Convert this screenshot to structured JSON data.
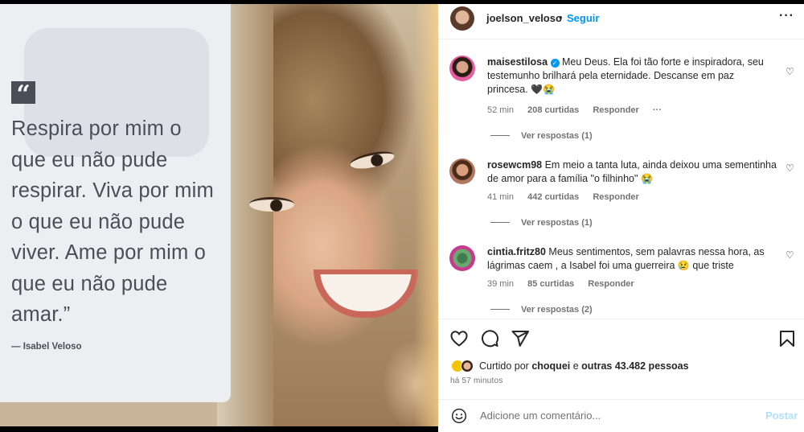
{
  "quote": {
    "mark": "“",
    "text": "Respira por mim o que eu não pude respirar. Viva por mim o que eu não pude viver. Ame por mim o que eu não pude amar.”",
    "author": "— Isabel Veloso"
  },
  "header": {
    "username": "joelson_veloso",
    "separator": "•",
    "follow_label": "Seguir",
    "more_label": "···"
  },
  "comments": [
    {
      "username": "maisestilosa",
      "verified": true,
      "text": "Meu Deus. Ela foi tão forte e inspiradora, seu testemunho brilhará pela eternidade. Descanse em paz princesa.",
      "emoji": "🖤😭",
      "time": "52 min",
      "likes": "208 curtidas",
      "reply_label": "Responder",
      "more_label": "···",
      "view_replies": "Ver respostas (1)"
    },
    {
      "username": "rosewcm98",
      "verified": false,
      "text": "Em meio a tanta luta, ainda deixou uma sementinha de amor para a família \"o filhinho\"",
      "emoji": "😭",
      "time": "41 min",
      "likes": "442 curtidas",
      "reply_label": "Responder",
      "view_replies": "Ver respostas (1)"
    },
    {
      "username": "cintia.fritz80",
      "verified": false,
      "text": "Meus sentimentos, sem palavras nessa hora, as lágrimas caem , a Isabel foi uma guerreira",
      "emoji": "😢",
      "text_after": "que triste",
      "time": "39 min",
      "likes": "85 curtidas",
      "reply_label": "Responder",
      "view_replies": "Ver respostas (2)"
    }
  ],
  "likes": {
    "prefix": "Curtido por",
    "user": "choquei",
    "middle": "e",
    "others": "outras 43.482 pessoas"
  },
  "posted_time": "há 57 minutos",
  "add_comment": {
    "placeholder": "Adicione um comentário...",
    "post_label": "Postar"
  },
  "icons": [
    "heart-icon",
    "comment-icon",
    "share-icon",
    "bookmark-icon",
    "emoji-icon",
    "more-icon"
  ],
  "colors": {
    "link_blue": "#0095f6",
    "post_disabled": "#b2dffc",
    "text": "#262626",
    "muted": "#737373",
    "quote_bg": "#eceef2"
  }
}
